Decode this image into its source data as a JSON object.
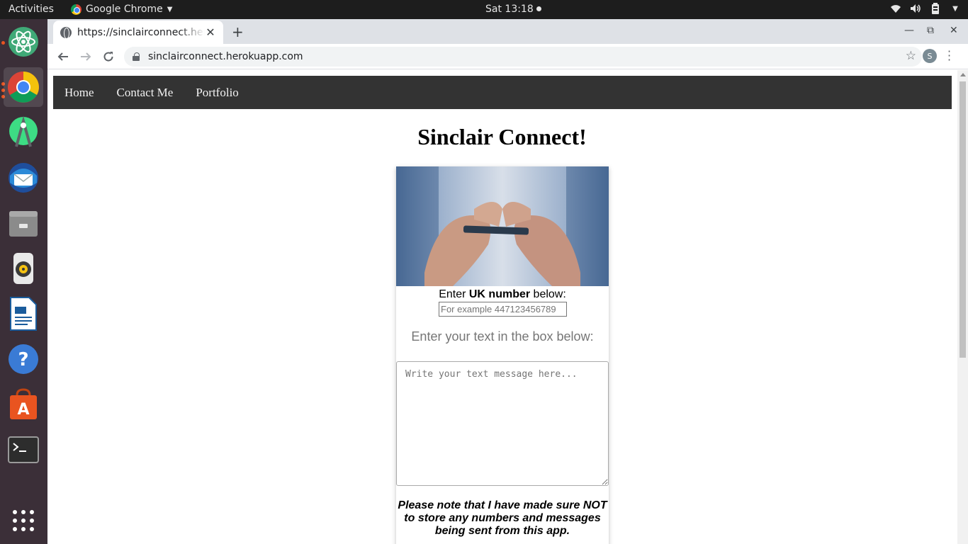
{
  "topbar": {
    "activities": "Activities",
    "app_name": "Google Chrome",
    "clock": "Sat 13:18"
  },
  "dock": {
    "items": [
      {
        "name": "Atom",
        "icon": "atom-icon"
      },
      {
        "name": "Google Chrome",
        "icon": "chrome-icon",
        "active": true
      },
      {
        "name": "Android Studio",
        "icon": "android-studio-icon"
      },
      {
        "name": "Thunderbird",
        "icon": "thunderbird-icon"
      },
      {
        "name": "Files",
        "icon": "files-icon"
      },
      {
        "name": "Rhythmbox",
        "icon": "rhythmbox-icon"
      },
      {
        "name": "LibreOffice Writer",
        "icon": "writer-icon"
      },
      {
        "name": "Help",
        "icon": "help-icon"
      },
      {
        "name": "Ubuntu Software",
        "icon": "software-icon"
      },
      {
        "name": "Terminal",
        "icon": "terminal-icon"
      },
      {
        "name": "Show Applications",
        "icon": "app-grid-icon"
      }
    ]
  },
  "browser": {
    "tab_title": "https://sinclairconnect.herokuapp.com",
    "url": "sinclairconnect.herokuapp.com",
    "profile_initial": "S"
  },
  "site": {
    "nav": [
      "Home",
      "Contact Me",
      "Portfolio"
    ],
    "title": "Sinclair Connect!",
    "number_label_prefix": "Enter ",
    "number_label_bold": "UK number",
    "number_label_suffix": " below:",
    "number_placeholder": "For example 447123456789",
    "text_label": "Enter your text in the box below:",
    "message_placeholder": "Write your text message here...",
    "note": "Please note that I have made sure NOT to store any numbers and messages being sent from this app."
  },
  "colors": {
    "nav_bg": "#333333",
    "dock_bg": "#3b2f38",
    "accent": "#e95420"
  }
}
